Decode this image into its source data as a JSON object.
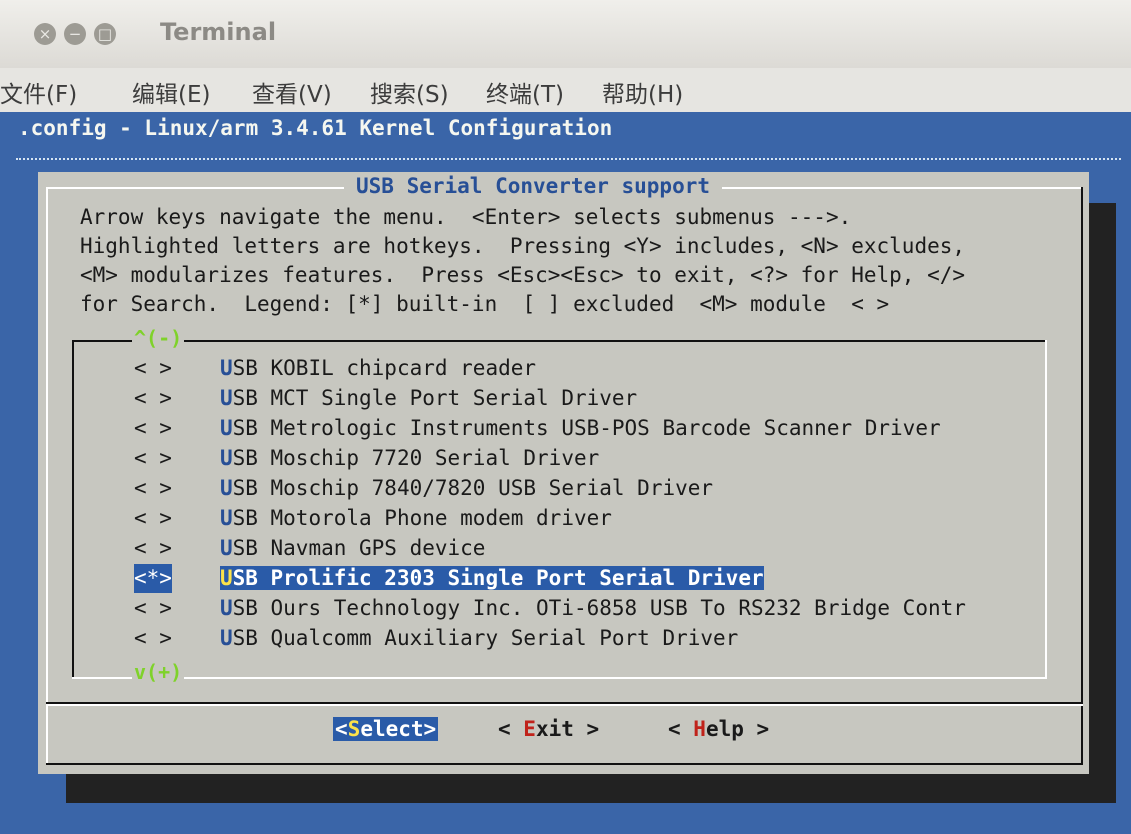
{
  "window": {
    "title": "Terminal",
    "close_glyph": "×",
    "minimize_glyph": "−",
    "maximize_glyph": "□"
  },
  "menubar": [
    "文件(F)",
    "编辑(E)",
    "查看(V)",
    "搜索(S)",
    "终端(T)",
    "帮助(H)"
  ],
  "config_title": ".config - Linux/arm 3.4.61 Kernel Configuration",
  "dialog": {
    "title": "USB Serial Converter support",
    "help_lines": [
      "Arrow keys navigate the menu.  <Enter> selects submenus --->.",
      "Highlighted letters are hotkeys.  Pressing <Y> includes, <N> excludes,",
      "<M> modularizes features.  Press <Esc><Esc> to exit, <?> for Help, </>",
      "for Search.  Legend: [*] built-in  [ ] excluded  <M> module  < >"
    ],
    "scroll_up": "^(-)",
    "scroll_down": "v(+)",
    "items": [
      {
        "state": "< >",
        "hotkey": "U",
        "label": "SB KOBIL chipcard reader"
      },
      {
        "state": "< >",
        "hotkey": "U",
        "label": "SB MCT Single Port Serial Driver"
      },
      {
        "state": "< >",
        "hotkey": "U",
        "label": "SB Metrologic Instruments USB-POS Barcode Scanner Driver"
      },
      {
        "state": "< >",
        "hotkey": "U",
        "label": "SB Moschip 7720 Serial Driver"
      },
      {
        "state": "< >",
        "hotkey": "U",
        "label": "SB Moschip 7840/7820 USB Serial Driver"
      },
      {
        "state": "< >",
        "hotkey": "U",
        "label": "SB Motorola Phone modem driver"
      },
      {
        "state": "< >",
        "hotkey": "U",
        "label": "SB Navman GPS device"
      },
      {
        "state": "<*>",
        "hotkey": "U",
        "label": "SB Prolific 2303 Single Port Serial Driver",
        "selected": true
      },
      {
        "state": "< >",
        "hotkey": "U",
        "label": "SB Ours Technology Inc. OTi-6858 USB To RS232 Bridge Contr"
      },
      {
        "state": "< >",
        "hotkey": "U",
        "label": "SB Qualcomm Auxiliary Serial Port Driver"
      }
    ],
    "buttons": {
      "select": {
        "open": "<",
        "hotkey": "S",
        "rest": "elect>"
      },
      "exit": {
        "open": "< ",
        "hotkey": "E",
        "rest": "xit >"
      },
      "help": {
        "open": "< ",
        "hotkey": "H",
        "rest": "elp >"
      }
    }
  },
  "colors": {
    "terminal_bg": "#3a65a8",
    "dialog_bg": "#c7c7c0",
    "highlight": "#2a5ba8",
    "hotkey_selected": "#fbe24a",
    "button_hotkey": "#c0221a",
    "scroll_arrow": "#7fd22a"
  }
}
